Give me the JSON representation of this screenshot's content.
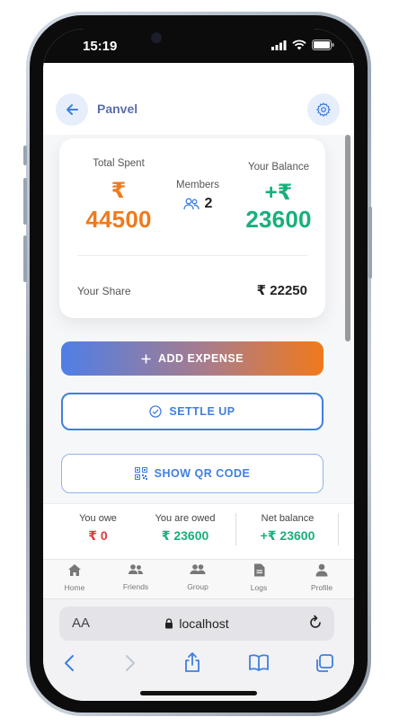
{
  "status_bar": {
    "time": "15:19"
  },
  "header": {
    "group_name": "Panvel"
  },
  "summary": {
    "total_spent_label": "Total Spent",
    "total_spent_symbol": "₹",
    "total_spent_value": "44500",
    "members_label": "Members",
    "members_count": "2",
    "your_balance_label": "Your Balance",
    "your_balance_symbol": "+₹",
    "your_balance_value": "23600",
    "your_share_label": "Your Share",
    "your_share_value": "₹ 22250"
  },
  "actions": {
    "add_expense": "ADD EXPENSE",
    "settle_up": "SETTLE UP",
    "show_qr": "SHOW QR CODE"
  },
  "balances": {
    "you_owe_label": "You owe",
    "you_owe_value": "₹ 0",
    "you_are_owed_label": "You are owed",
    "you_are_owed_value": "₹ 23600",
    "net_balance_label": "Net balance",
    "net_balance_value": "+₹ 23600"
  },
  "tabs": [
    {
      "label": "Home",
      "icon": "home-icon"
    },
    {
      "label": "Friends",
      "icon": "friends-icon"
    },
    {
      "label": "Group",
      "icon": "group-icon"
    },
    {
      "label": "Logs",
      "icon": "logs-icon"
    },
    {
      "label": "Profile",
      "icon": "profile-icon"
    }
  ],
  "browser": {
    "aa_label": "AA",
    "url": "localhost"
  },
  "colors": {
    "orange": "#f07a1c",
    "green": "#18b07a",
    "blue": "#3f7fe0",
    "red": "#e03a3a"
  }
}
